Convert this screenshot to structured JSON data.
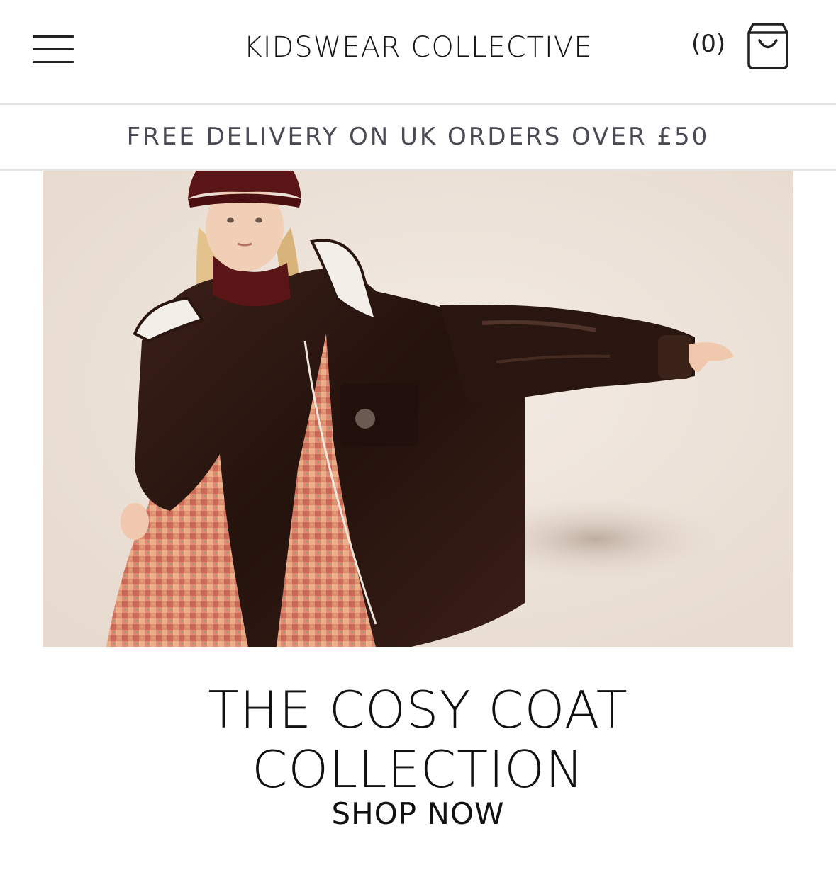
{
  "header": {
    "brand": "KIDSWEAR COLLECTIVE",
    "cart_count": "(0)",
    "menu_icon": "hamburger-menu-icon",
    "cart_icon": "shopping-bag-icon"
  },
  "promo_banner": {
    "text": "FREE DELIVERY ON UK ORDERS OVER £50"
  },
  "hero": {
    "headline_line1": "THE COSY COAT",
    "headline_line2": "COLLECTION",
    "cta": "SHOP NOW"
  },
  "colors": {
    "text": "#111111",
    "promo_text": "#4a4a55",
    "divider": "#e4e4e6",
    "hero_background": "#ece2d8",
    "coat": "#2b1711",
    "dress": "#d9826b",
    "hat": "#5a1516"
  }
}
